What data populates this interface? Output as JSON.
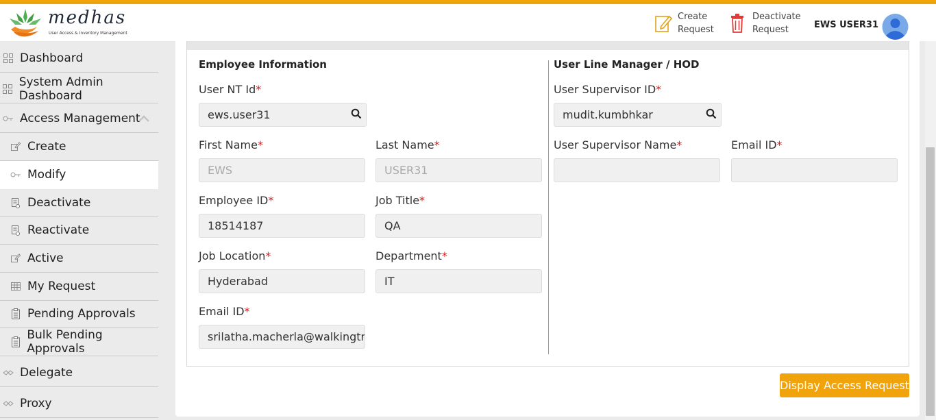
{
  "header": {
    "logo_text": "medhas",
    "logo_tagline": "User Access & Inventory Management",
    "create_request": "Create Request",
    "deactivate_request": "Deactivate Request",
    "username": "EWS USER31",
    "accent_color": "#f0a30a"
  },
  "sidebar": {
    "items": [
      {
        "label": "Dashboard",
        "icon": "grid-icon"
      },
      {
        "label": "System Admin Dashboard",
        "icon": "grid-icon"
      },
      {
        "label": "Access Management",
        "icon": "key-icon",
        "expanded": true
      },
      {
        "label": "Create",
        "icon": "edit-icon"
      },
      {
        "label": "Modify",
        "icon": "key-icon",
        "active": true
      },
      {
        "label": "Deactivate",
        "icon": "document-icon"
      },
      {
        "label": "Reactivate",
        "icon": "document-icon"
      },
      {
        "label": "Active",
        "icon": "edit-icon"
      },
      {
        "label": "My Request",
        "icon": "table-icon"
      },
      {
        "label": "Pending Approvals",
        "icon": "clipboard-icon"
      },
      {
        "label": "Bulk Pending Approvals",
        "icon": "clipboard-icon"
      },
      {
        "label": "Delegate",
        "icon": "handshake-icon"
      },
      {
        "label": "Proxy",
        "icon": "handshake-icon"
      }
    ]
  },
  "form": {
    "employee_section_title": "Employee Information",
    "manager_section_title": "User Line Manager / HOD",
    "required_marker": "*",
    "user_nt_id": {
      "label": "User NT Id",
      "value": "ews.user31"
    },
    "first_name": {
      "label": "First Name",
      "value": "EWS"
    },
    "last_name": {
      "label": "Last Name",
      "value": "USER31"
    },
    "employee_id": {
      "label": "Employee ID",
      "value": "18514187"
    },
    "job_title": {
      "label": "Job Title",
      "value": "QA"
    },
    "job_location": {
      "label": "Job Location",
      "value": "Hyderabad"
    },
    "department": {
      "label": "Department",
      "value": "IT"
    },
    "email_id": {
      "label": "Email ID",
      "value": "srilatha.macherla@walkingtre"
    },
    "supervisor_id": {
      "label": "User Supervisor ID",
      "value": "mudit.kumbhkar"
    },
    "supervisor_name": {
      "label": "User Supervisor Name",
      "value": ""
    },
    "supervisor_email": {
      "label": "Email ID",
      "value": ""
    }
  },
  "actions": {
    "display_access_request": "Display Access Request"
  }
}
